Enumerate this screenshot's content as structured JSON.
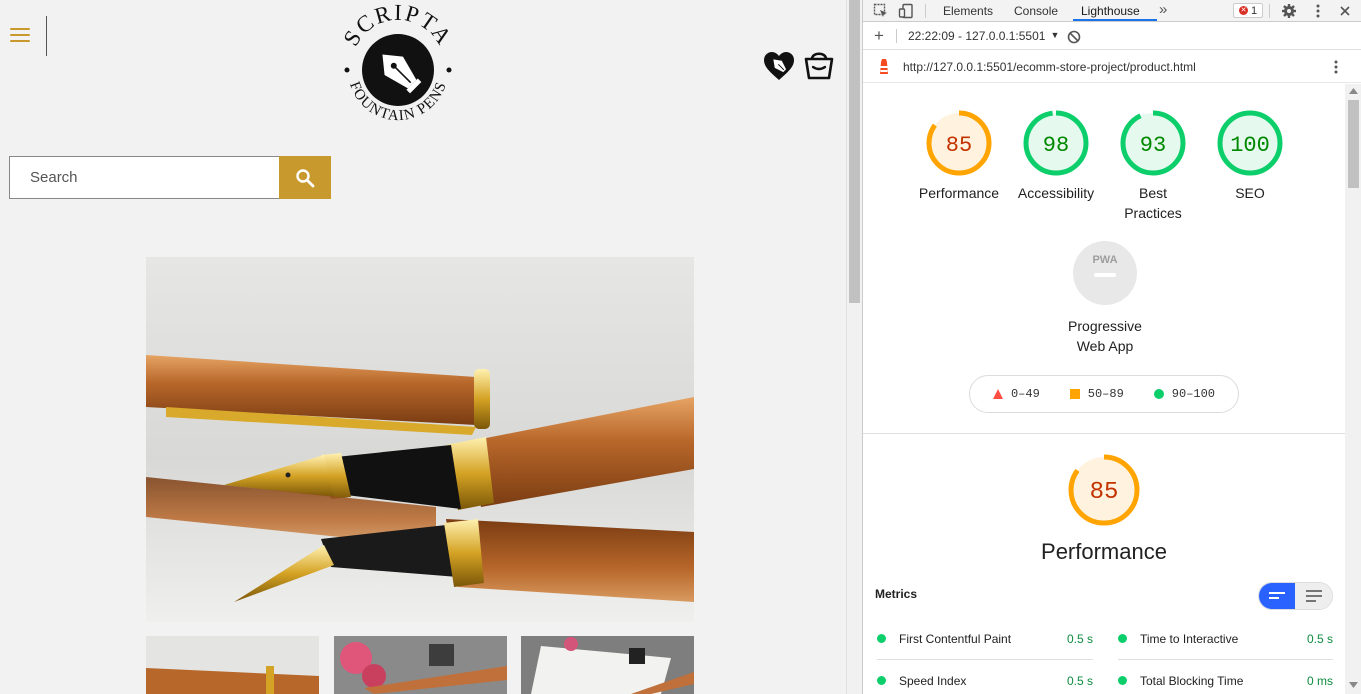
{
  "store": {
    "logo_top": "SCRIPTA",
    "logo_bottom": "FOUNTAIN PENS",
    "search": {
      "placeholder": "Search"
    }
  },
  "devtools": {
    "tabs": [
      "Elements",
      "Console",
      "Lighthouse"
    ],
    "active_tab": "Lighthouse",
    "error_count": "1",
    "report_select": "22:22:09 - 127.0.0.1:5501",
    "url": "http://127.0.0.1:5501/ecomm-store-project/product.html",
    "scores": [
      {
        "label": "Performance",
        "value": "85",
        "fraction": 0.85,
        "color": "#ffa400",
        "bg": "#fff3e0",
        "text": "#c33300"
      },
      {
        "label": "Accessibility",
        "value": "98",
        "fraction": 0.98,
        "color": "#0cce6b",
        "bg": "#e6f9ee",
        "text": "#008800"
      },
      {
        "label": "Best Practices",
        "value": "93",
        "fraction": 0.93,
        "color": "#0cce6b",
        "bg": "#e6f9ee",
        "text": "#008800"
      },
      {
        "label": "SEO",
        "value": "100",
        "fraction": 1.0,
        "color": "#0cce6b",
        "bg": "#e6f9ee",
        "text": "#008800"
      }
    ],
    "pwa": {
      "badge": "PWA",
      "label_line1": "Progressive",
      "label_line2": "Web App"
    },
    "legend": [
      {
        "range": "0–49",
        "color": "#ff4e42"
      },
      {
        "range": "50–89",
        "color": "#ffa400"
      },
      {
        "range": "90–100",
        "color": "#0cce6b"
      }
    ],
    "performance": {
      "value": "85",
      "fraction": 0.85,
      "title": "Performance"
    },
    "metrics_header": "Metrics",
    "metrics": [
      {
        "name": "First Contentful Paint",
        "value": "0.5 s"
      },
      {
        "name": "Time to Interactive",
        "value": "0.5 s"
      },
      {
        "name": "Speed Index",
        "value": "0.5 s"
      },
      {
        "name": "Total Blocking Time",
        "value": "0 ms"
      }
    ]
  }
}
